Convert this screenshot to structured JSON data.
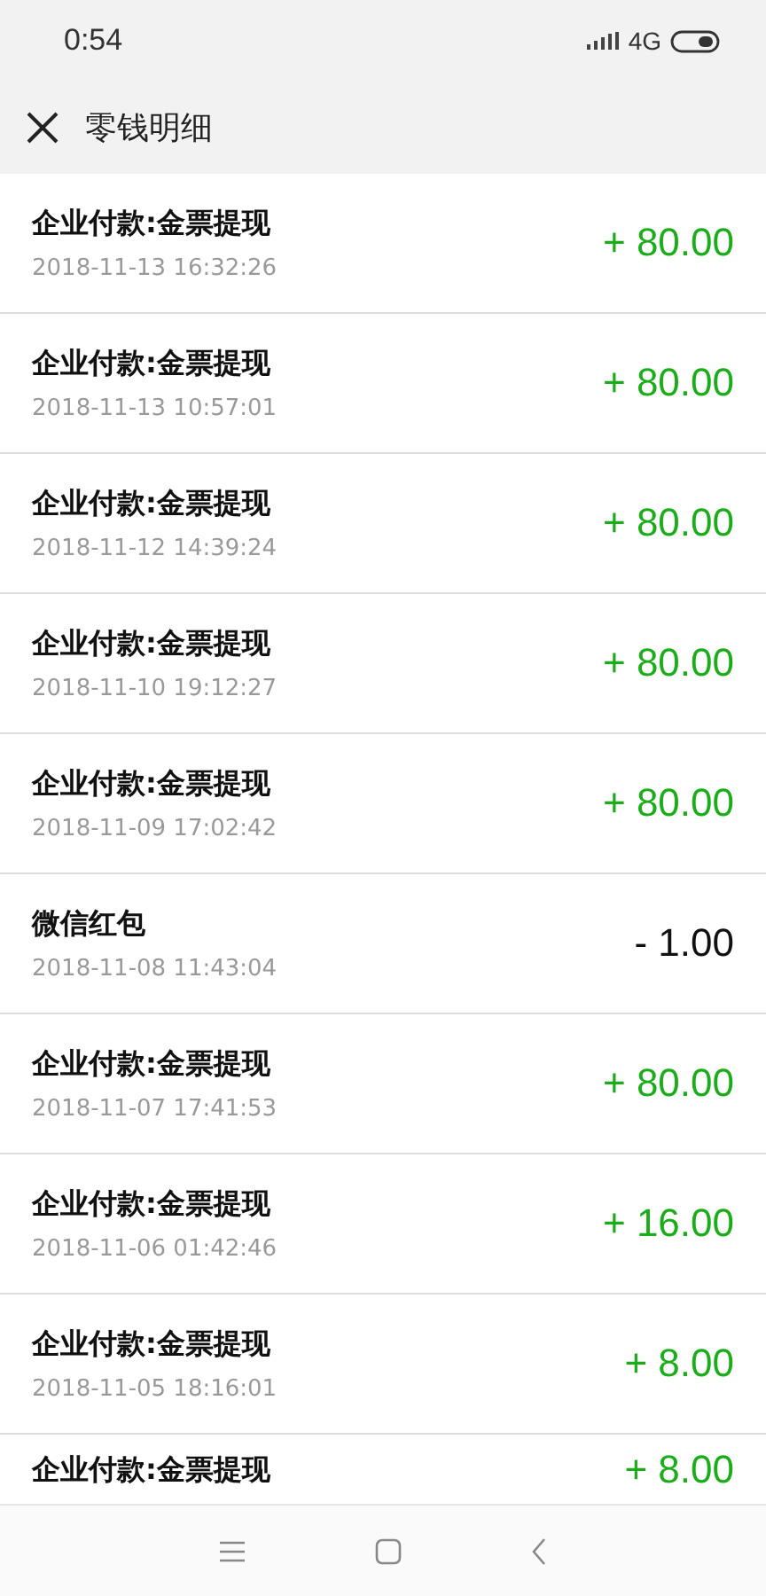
{
  "status_bar": {
    "time": "0:54",
    "network": "4G"
  },
  "header": {
    "title": "零钱明细"
  },
  "transactions": [
    {
      "title": "企业付款:金票提现",
      "date": "2018-11-13 16:32:26",
      "amount": "+ 80.00",
      "kind": "income"
    },
    {
      "title": "企业付款:金票提现",
      "date": "2018-11-13 10:57:01",
      "amount": "+ 80.00",
      "kind": "income"
    },
    {
      "title": "企业付款:金票提现",
      "date": "2018-11-12 14:39:24",
      "amount": "+ 80.00",
      "kind": "income"
    },
    {
      "title": "企业付款:金票提现",
      "date": "2018-11-10 19:12:27",
      "amount": "+ 80.00",
      "kind": "income"
    },
    {
      "title": "企业付款:金票提现",
      "date": "2018-11-09 17:02:42",
      "amount": "+ 80.00",
      "kind": "income"
    },
    {
      "title": "微信红包",
      "date": "2018-11-08 11:43:04",
      "amount": "- 1.00",
      "kind": "expense"
    },
    {
      "title": "企业付款:金票提现",
      "date": "2018-11-07 17:41:53",
      "amount": "+ 80.00",
      "kind": "income"
    },
    {
      "title": "企业付款:金票提现",
      "date": "2018-11-06 01:42:46",
      "amount": "+ 16.00",
      "kind": "income"
    },
    {
      "title": "企业付款:金票提现",
      "date": "2018-11-05 18:16:01",
      "amount": "+ 8.00",
      "kind": "income"
    },
    {
      "title": "企业付款:金票提现",
      "amount": "+ 8.00",
      "kind": "income"
    }
  ]
}
